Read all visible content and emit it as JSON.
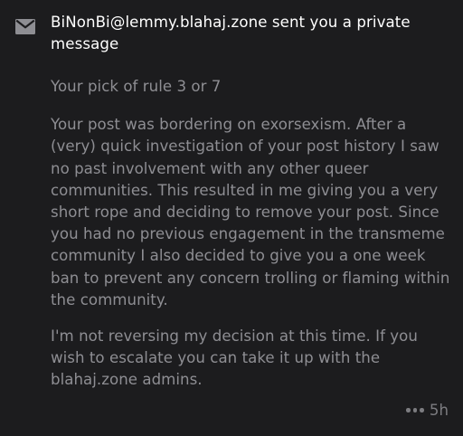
{
  "notification": {
    "icon": "mail-icon",
    "header": "BiNonBi@lemmy.blahaj.zone sent you a private message",
    "subject": "Your pick of rule 3 or 7",
    "body": [
      "Your post was bordering on exorsexism. After a (very) quick investigation of your post history I saw no past involvement with any other queer communities. This resulted in me giving you a very short rope and deciding to remove your post. Since you had no previous engagement in the transmeme community I also decided to give you a one week ban to prevent any concern trolling or flaming within the community.",
      "I'm not reversing my decision at this time. If you wish to escalate you can take it up with the blahaj.zone admins."
    ],
    "more_icon": "ellipsis-icon",
    "timestamp": "5h"
  },
  "colors": {
    "background": "#1c1c1e",
    "header_text": "#ffffff",
    "body_text": "#8e8e93",
    "muted": "#7c7c80"
  }
}
